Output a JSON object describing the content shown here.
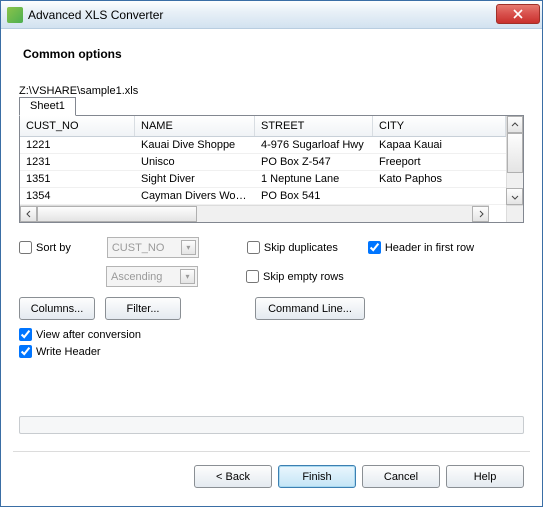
{
  "window": {
    "title": "Advanced XLS Converter"
  },
  "heading": "Common options",
  "filepath": "Z:\\VSHARE\\sample1.xls",
  "tab": "Sheet1",
  "grid": {
    "headers": [
      "CUST_NO",
      "NAME",
      "STREET",
      "CITY"
    ],
    "rows": [
      [
        "1221",
        "Kauai Dive Shoppe",
        "4-976 Sugarloaf Hwy",
        "Kapaa Kauai"
      ],
      [
        "1231",
        "Unisco",
        "PO Box Z-547",
        "Freeport"
      ],
      [
        "1351",
        "Sight Diver",
        "1 Neptune Lane",
        "Kato Paphos"
      ],
      [
        "1354",
        "Cayman Divers Worl...",
        "PO Box 541",
        ""
      ]
    ]
  },
  "options": {
    "sort_by_label": "Sort by",
    "sort_by_checked": false,
    "sort_column": "CUST_NO",
    "sort_order": "Ascending",
    "skip_duplicates_label": "Skip duplicates",
    "skip_duplicates_checked": false,
    "header_first_row_label": "Header in first row",
    "header_first_row_checked": true,
    "skip_empty_label": "Skip empty rows",
    "skip_empty_checked": false,
    "view_after_label": "View after conversion",
    "view_after_checked": true,
    "write_header_label": "Write Header",
    "write_header_checked": true
  },
  "buttons": {
    "columns": "Columns...",
    "filter": "Filter...",
    "command_line": "Command Line...",
    "back": "< Back",
    "finish": "Finish",
    "cancel": "Cancel",
    "help": "Help"
  }
}
